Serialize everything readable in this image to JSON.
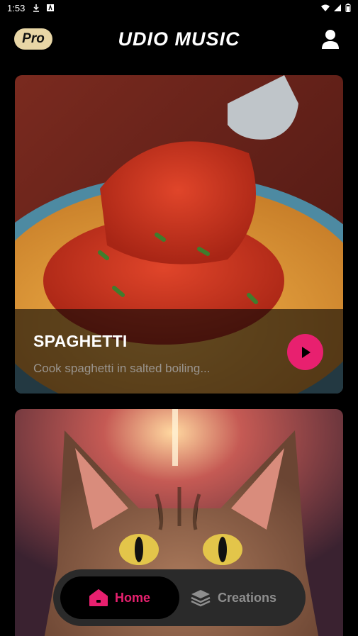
{
  "status_bar": {
    "time": "1:53",
    "left_icons": [
      "download-icon",
      "a-icon"
    ],
    "right_icons": [
      "wifi-icon",
      "signal-icon",
      "battery-icon"
    ]
  },
  "header": {
    "pro_label": "Pro",
    "title": "UDIO MUSIC",
    "profile_icon": "person-icon"
  },
  "cards": [
    {
      "title": "SPAGHETTI",
      "description": "Cook spaghetti in salted boiling...",
      "play_icon": "play-icon"
    },
    {
      "title": "",
      "description": ""
    }
  ],
  "bottom_nav": {
    "items": [
      {
        "label": "Home",
        "icon": "home-icon",
        "active": true
      },
      {
        "label": "Creations",
        "icon": "layers-icon",
        "active": false
      }
    ]
  },
  "colors": {
    "accent": "#e8206f",
    "pro_badge": "#e8d6a6",
    "nav_bg": "#2a2a2a",
    "inactive_text": "#8e8e8e"
  }
}
